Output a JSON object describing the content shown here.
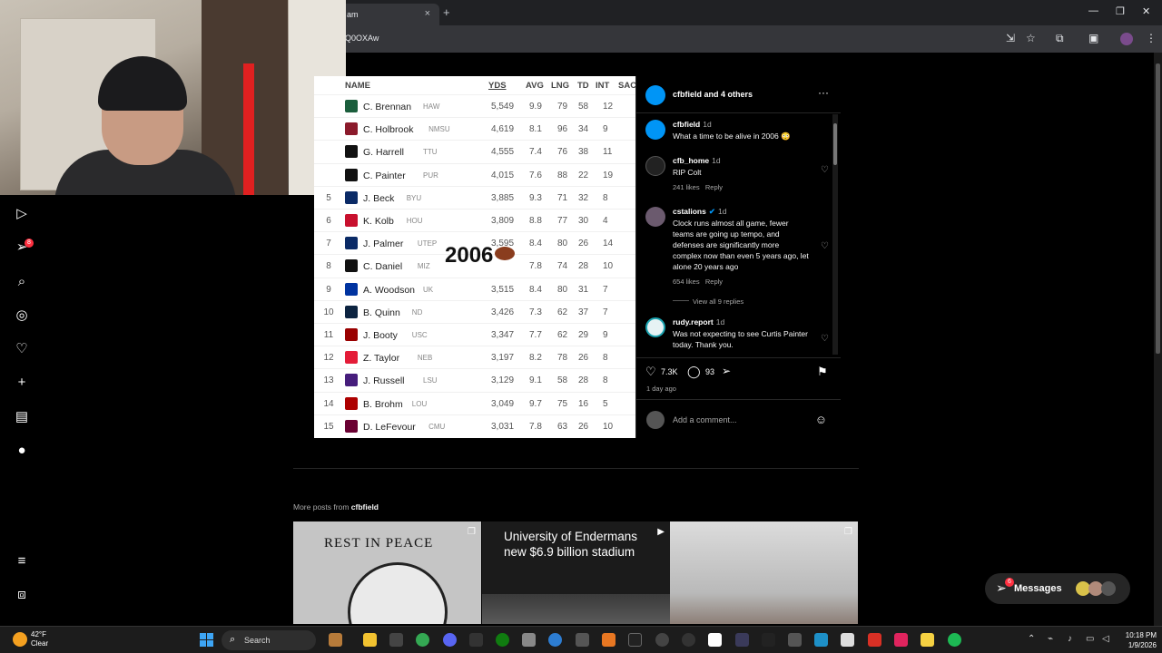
{
  "browser": {
    "tab_title": "am",
    "tab_close": "×",
    "new_tab": "+",
    "url": "Q0OXAw",
    "window_minimize": "—",
    "window_maximize": "❐",
    "window_close": "✕"
  },
  "overlay_text": "2006",
  "stats_table": {
    "headers": {
      "name": "NAME",
      "yds": "YDS",
      "avg": "AVG",
      "lng": "LNG",
      "td": "TD",
      "int": "INT",
      "sack": "SAC"
    },
    "rows": [
      {
        "rank": "",
        "player": "C. Brennan",
        "team": "HAW",
        "yds": "5,549",
        "avg": "9.9",
        "lng": "79",
        "td": "58",
        "int": "12",
        "logo_color": "#1b5e3c"
      },
      {
        "rank": "",
        "player": "C. Holbrook",
        "team": "NMSU",
        "yds": "4,619",
        "avg": "8.1",
        "lng": "96",
        "td": "34",
        "int": "9",
        "logo_color": "#8b1a2b"
      },
      {
        "rank": "",
        "player": "G. Harrell",
        "team": "TTU",
        "yds": "4,555",
        "avg": "7.4",
        "lng": "76",
        "td": "38",
        "int": "11",
        "logo_color": "#111111"
      },
      {
        "rank": "",
        "player": "C. Painter",
        "team": "PUR",
        "yds": "4,015",
        "avg": "7.6",
        "lng": "88",
        "td": "22",
        "int": "19",
        "logo_color": "#111111"
      },
      {
        "rank": "5",
        "player": "J. Beck",
        "team": "BYU",
        "yds": "3,885",
        "avg": "9.3",
        "lng": "71",
        "td": "32",
        "int": "8",
        "logo_color": "#0a2a66"
      },
      {
        "rank": "6",
        "player": "K. Kolb",
        "team": "HOU",
        "yds": "3,809",
        "avg": "8.8",
        "lng": "77",
        "td": "30",
        "int": "4",
        "logo_color": "#c8102e"
      },
      {
        "rank": "7",
        "player": "J. Palmer",
        "team": "UTEP",
        "yds": "3,595",
        "avg": "8.4",
        "lng": "80",
        "td": "26",
        "int": "14",
        "logo_color": "#0a2a66"
      },
      {
        "rank": "8",
        "player": "C. Daniel",
        "team": "MIZ",
        "yds": "",
        "avg": "7.8",
        "lng": "74",
        "td": "28",
        "int": "10",
        "logo_color": "#111111"
      },
      {
        "rank": "9",
        "player": "A. Woodson",
        "team": "UK",
        "yds": "3,515",
        "avg": "8.4",
        "lng": "80",
        "td": "31",
        "int": "7",
        "logo_color": "#0033a0"
      },
      {
        "rank": "10",
        "player": "B. Quinn",
        "team": "ND",
        "yds": "3,426",
        "avg": "7.3",
        "lng": "62",
        "td": "37",
        "int": "7",
        "logo_color": "#0c2340"
      },
      {
        "rank": "11",
        "player": "J. Booty",
        "team": "USC",
        "yds": "3,347",
        "avg": "7.7",
        "lng": "62",
        "td": "29",
        "int": "9",
        "logo_color": "#990000"
      },
      {
        "rank": "12",
        "player": "Z. Taylor",
        "team": "NEB",
        "yds": "3,197",
        "avg": "8.2",
        "lng": "78",
        "td": "26",
        "int": "8",
        "logo_color": "#e41c38"
      },
      {
        "rank": "13",
        "player": "J. Russell",
        "team": "LSU",
        "yds": "3,129",
        "avg": "9.1",
        "lng": "58",
        "td": "28",
        "int": "8",
        "logo_color": "#461d7c"
      },
      {
        "rank": "14",
        "player": "B. Brohm",
        "team": "LOU",
        "yds": "3,049",
        "avg": "9.7",
        "lng": "75",
        "td": "16",
        "int": "5",
        "logo_color": "#ad0000"
      },
      {
        "rank": "15",
        "player": "D. LeFevour",
        "team": "CMU",
        "yds": "3,031",
        "avg": "7.8",
        "lng": "63",
        "td": "26",
        "int": "10",
        "logo_color": "#6a0032"
      }
    ]
  },
  "post": {
    "header": "cfbfield and 4 others",
    "caption": {
      "user": "cfbfield",
      "time": "1d",
      "text": "What a time to be alive in 2006 😳"
    },
    "comments": [
      {
        "user": "cfb_home",
        "time": "1d",
        "text": "RIP Colt",
        "likes": "241 likes",
        "reply": "Reply"
      },
      {
        "user": "cstalions",
        "time": "1d",
        "text": "Clock runs almost all game, fewer teams are going up tempo, and defenses are significantly more complex now than even 5 years ago, let alone 20 years ago",
        "likes": "654 likes",
        "reply": "Reply"
      },
      {
        "user": "rudy.report",
        "time": "1d",
        "text": "Was not expecting to see Curtis Painter today. Thank you.",
        "likes": "",
        "reply": ""
      }
    ],
    "view_replies": "View all 9 replies",
    "like_count": "7.3K",
    "comment_count": "93",
    "time_ago": "1 day ago",
    "add_comment_placeholder": "Add a comment..."
  },
  "more_posts": {
    "label": "More posts from",
    "user": "cfbfield",
    "thumbs": [
      {
        "title": "REST IN PEACE"
      },
      {
        "title": "University of Endermans new $6.9 billion stadium"
      },
      {
        "title": ""
      }
    ]
  },
  "messages": {
    "label": "Messages",
    "badge": "6"
  },
  "sidebar": {
    "notification_badge": "8"
  },
  "taskbar": {
    "weather_temp": "42°F",
    "weather_desc": "Clear",
    "search_label": "Search",
    "time": "10:18 PM",
    "date": "1/9/2026"
  }
}
